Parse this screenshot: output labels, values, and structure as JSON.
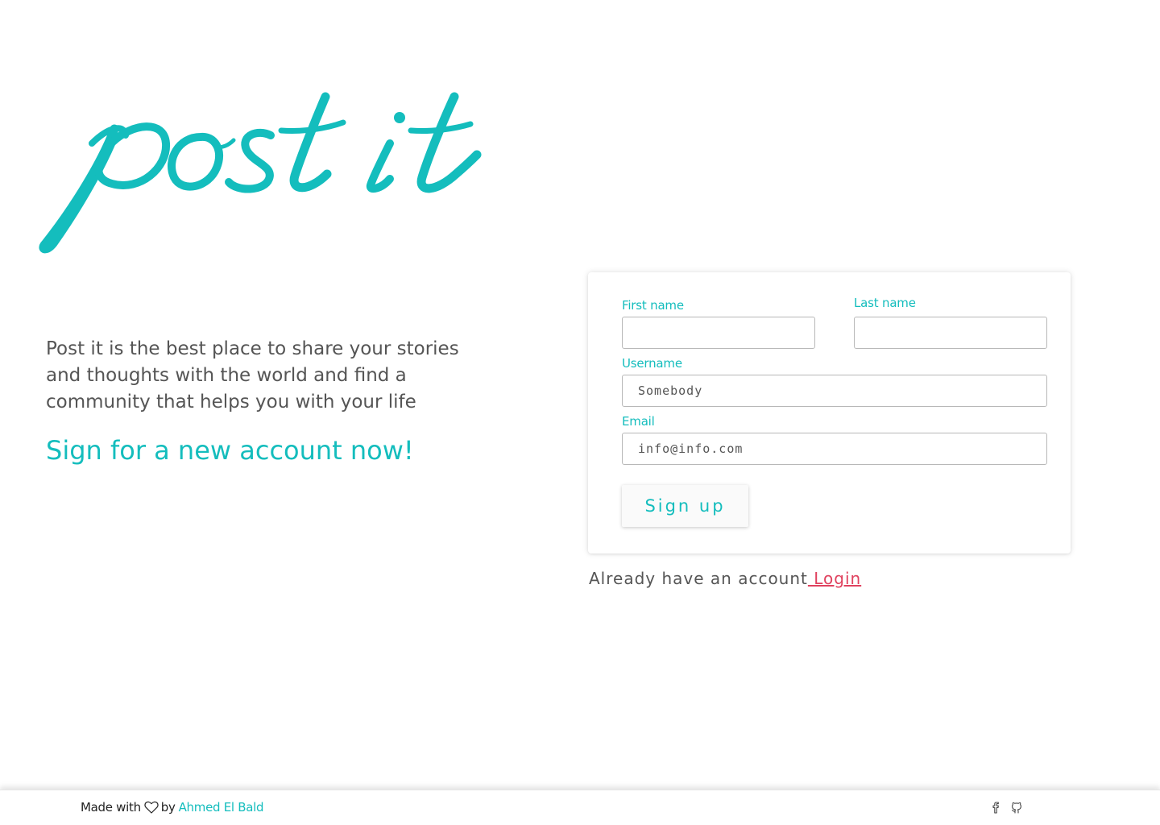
{
  "brand": {
    "logo_text": "post it",
    "color": "#14bdbd"
  },
  "hero": {
    "description": "Post it is the best place to share your stories and thoughts with the world and find a community that helps you with your life",
    "cta": "Sign for a new account now!"
  },
  "form": {
    "first_name": {
      "label": "First name",
      "value": ""
    },
    "last_name": {
      "label": "Last name",
      "value": ""
    },
    "username": {
      "label": "Username",
      "value": "Somebody"
    },
    "email": {
      "label": "Email",
      "value": "info@info.com"
    },
    "submit_label": "Sign up"
  },
  "login_prompt": {
    "text": "Already have an account",
    "link_label": " Login",
    "link_color": "#e0415e"
  },
  "footer": {
    "made_with": "Made with",
    "heart_icon": "heart-icon",
    "by": "by",
    "author": "Ahmed El Bald",
    "social_icons": [
      "facebook-icon",
      "github-icon"
    ]
  }
}
